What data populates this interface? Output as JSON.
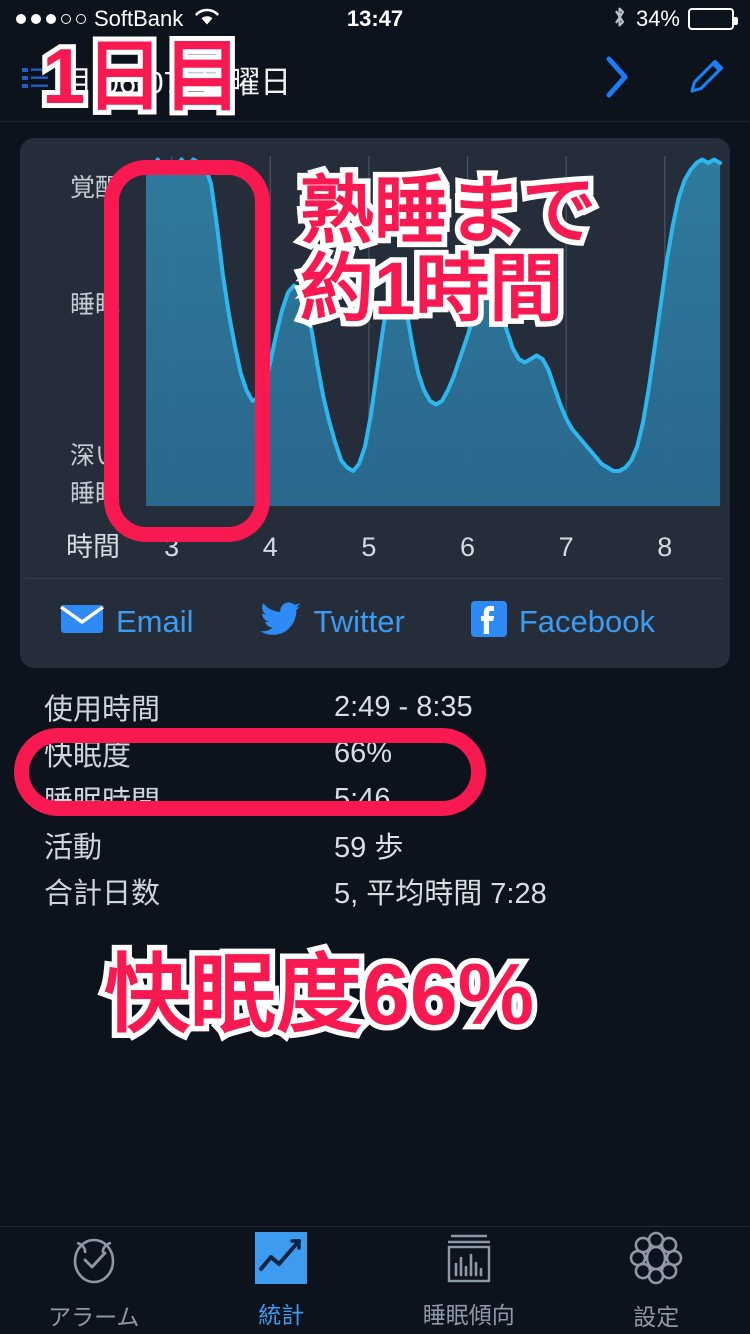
{
  "status_bar": {
    "signal_dots_filled": 3,
    "signal_dots_total": 5,
    "carrier": "SoftBank",
    "wifi_icon": "wifi-icon",
    "time": "13:47",
    "bluetooth_icon": "bluetooth-icon",
    "battery_percent": "34%",
    "battery_level": 34
  },
  "navbar": {
    "list_icon": "list-icon",
    "title": "月 06-07, 日曜日",
    "next_icon": "chevron-right-icon",
    "edit_icon": "pencil-edit-icon"
  },
  "chart_data": {
    "type": "line",
    "title": "",
    "xlabel": "時間",
    "ylabel": "",
    "y_categories": [
      "覚醒",
      "睡眠",
      "深い睡眠"
    ],
    "x_ticks": [
      "3",
      "4",
      "5",
      "6",
      "7",
      "8"
    ],
    "xlim": [
      2.72,
      8.6
    ],
    "ylim": [
      0,
      100
    ],
    "grid": true,
    "series": [
      {
        "name": "sleep-depth",
        "line_color": "#2eb7ef",
        "fill_color": "#2a6a8c",
        "x": [
          2.74,
          2.8,
          2.86,
          2.92,
          2.98,
          3.04,
          3.1,
          3.16,
          3.22,
          3.28,
          3.34,
          3.4,
          3.46,
          3.52,
          3.58,
          3.64,
          3.7,
          3.76,
          3.82,
          3.88,
          3.94,
          4.0,
          4.06,
          4.12,
          4.18,
          4.24,
          4.3,
          4.36,
          4.42,
          4.48,
          4.54,
          4.6,
          4.66,
          4.72,
          4.78,
          4.84,
          4.9,
          4.96,
          5.02,
          5.08,
          5.14,
          5.2,
          5.26,
          5.32,
          5.38,
          5.44,
          5.5,
          5.56,
          5.62,
          5.68,
          5.74,
          5.8,
          5.86,
          5.92,
          5.98,
          6.04,
          6.1,
          6.16,
          6.22,
          6.28,
          6.34,
          6.4,
          6.46,
          6.52,
          6.58,
          6.64,
          6.7,
          6.76,
          6.82,
          6.88,
          6.94,
          7.0,
          7.06,
          7.12,
          7.18,
          7.24,
          7.3,
          7.36,
          7.42,
          7.48,
          7.54,
          7.6,
          7.66,
          7.72,
          7.78,
          7.84,
          7.9,
          7.96,
          8.02,
          8.08,
          8.14,
          8.2,
          8.26,
          8.32,
          8.38,
          8.44,
          8.5,
          8.56
        ],
        "y": [
          98,
          97,
          99,
          96,
          98,
          97,
          99,
          97,
          99,
          98,
          97,
          92,
          80,
          66,
          55,
          46,
          38,
          33,
          30,
          31,
          34,
          41,
          49,
          56,
          61,
          63,
          62,
          58,
          50,
          40,
          31,
          24,
          18,
          13,
          11,
          10,
          12,
          17,
          26,
          38,
          50,
          60,
          66,
          64,
          56,
          46,
          38,
          33,
          30,
          29,
          30,
          33,
          37,
          42,
          47,
          52,
          57,
          60,
          61,
          59,
          55,
          50,
          45,
          42,
          41,
          42,
          43,
          42,
          39,
          34,
          29,
          25,
          22,
          20,
          18,
          16,
          14,
          12,
          11,
          10,
          10,
          11,
          13,
          17,
          24,
          34,
          46,
          58,
          70,
          80,
          88,
          93,
          96,
          98,
          99,
          98,
          99,
          98
        ]
      }
    ]
  },
  "share": {
    "items": [
      {
        "icon": "email-icon",
        "label": "Email"
      },
      {
        "icon": "twitter-icon",
        "label": "Twitter"
      },
      {
        "icon": "facebook-icon",
        "label": "Facebook"
      }
    ]
  },
  "stats": {
    "rows": [
      {
        "label": "使用時間",
        "value": "2:49 - 8:35"
      },
      {
        "label": "快眠度",
        "value": "66%"
      },
      {
        "label": "睡眠時間",
        "value": "5:46"
      },
      {
        "label": "活動",
        "value": "59 歩"
      },
      {
        "label": "合計日数",
        "value": "5, 平均時間 7:28"
      }
    ]
  },
  "tabbar": {
    "tabs": [
      {
        "icon": "alarm-clock-icon",
        "label": "アラーム",
        "active": false
      },
      {
        "icon": "statistics-chart-icon",
        "label": "統計",
        "active": true
      },
      {
        "icon": "sleep-trend-icon",
        "label": "睡眠傾向",
        "active": false
      },
      {
        "icon": "gear-icon",
        "label": "設定",
        "active": false
      }
    ]
  },
  "annotations": {
    "day_label": "1日目",
    "deep_sleep_note": "熟睡まで\n約1時間",
    "score_note": "快眠度66%",
    "highlight_color": "#f7194f",
    "outline_color": "#ffffff"
  }
}
